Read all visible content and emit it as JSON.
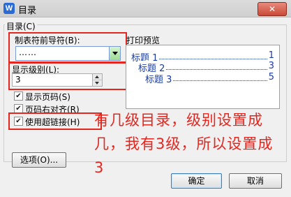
{
  "window": {
    "title": "目录",
    "app_icon": "W",
    "close": "✕"
  },
  "group": {
    "label": "目录(C)"
  },
  "tab_leader": {
    "label": "制表符前导符(B):",
    "value": "……"
  },
  "show_levels": {
    "label": "显示级别(L):",
    "value": "3"
  },
  "checkboxes": [
    {
      "label": "显示页码(S)",
      "checked": true
    },
    {
      "label": "页码右对齐(R)",
      "checked": true
    },
    {
      "label": "使用超链接(H)",
      "checked": true
    }
  ],
  "preview": {
    "label": "打印预览",
    "entries": [
      {
        "text": "标题 1",
        "page": "1"
      },
      {
        "text": "标题 2",
        "page": "3"
      },
      {
        "text": "标题 3",
        "page": "5"
      }
    ]
  },
  "buttons": {
    "options": "选项(O)...",
    "ok": "确定",
    "cancel": "取消"
  },
  "annotation": "有几级目录，级别设置成几，我有3级，所以设置成3",
  "colors": {
    "annotation": "#e4261f",
    "preview_text": "#1c3c9c"
  }
}
